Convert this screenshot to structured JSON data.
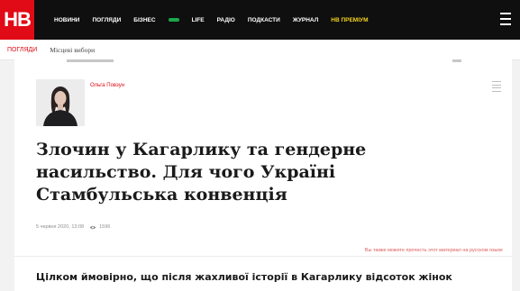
{
  "brand": {
    "logo_text": "НВ"
  },
  "nav": {
    "items": [
      {
        "label": "НОВИНИ",
        "style": ""
      },
      {
        "label": "ПОГЛЯДИ",
        "style": ""
      },
      {
        "label": "БІЗНЕС",
        "style": ""
      },
      {
        "label": "",
        "style": "green"
      },
      {
        "label": "LIFE",
        "style": ""
      },
      {
        "label": "РАДІО",
        "style": ""
      },
      {
        "label": "ПОДКАСТИ",
        "style": ""
      },
      {
        "label": "ЖУРНАЛ",
        "style": ""
      },
      {
        "label": "НВ ПРЕМІУМ",
        "style": "yellow"
      }
    ],
    "menu_icon": "hamburger-icon"
  },
  "breadcrumb": {
    "section": "ПОГЛЯДИ",
    "tag": "Місцеві вибори"
  },
  "article": {
    "author": {
      "name": "Ольга Повзун",
      "role": "",
      "photo_icon": "author-portrait"
    },
    "share_icon": "share-lines-icon",
    "title": "Злочин у Кагарлику та гендерне насильство. Для чого Україні Стамбульська конвенція",
    "meta": {
      "date": "5 червня 2020, 13:08",
      "views": "1596",
      "views_icon": "eye-icon"
    },
    "ru_link": "Вы также можете прочесть этот материал на русском языке",
    "lead": "Цілком ймовірно, що після жахливої історії в Кагарлику відсоток жінок"
  },
  "colors": {
    "brand_red": "#e00b16",
    "nav_bg": "#0f0f0f",
    "nav_green": "#1aa84b",
    "nav_yellow": "#f2d21b"
  }
}
